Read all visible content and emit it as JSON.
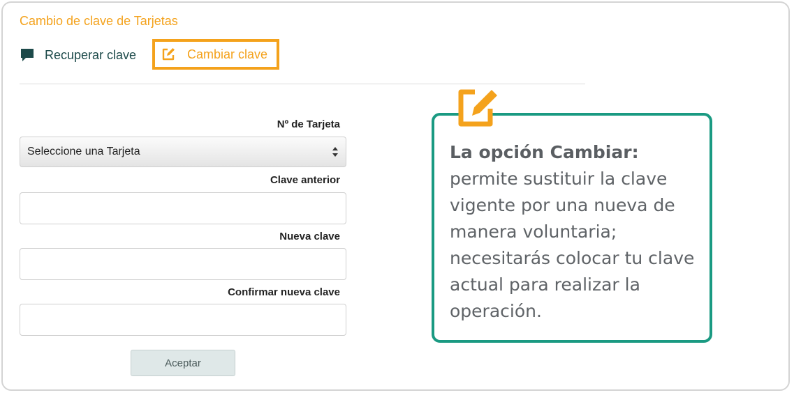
{
  "page": {
    "title": "Cambio de clave de Tarjetas"
  },
  "tabs": [
    {
      "label": "Recuperar clave",
      "icon": "chat-bubble-icon"
    },
    {
      "label": "Cambiar clave",
      "icon": "edit-icon",
      "active": true
    }
  ],
  "form": {
    "card_label": "Nº de Tarjeta",
    "card_select_value": "Seleccione una Tarjeta",
    "old_password_label": "Clave anterior",
    "old_password_value": "",
    "new_password_label": "Nueva clave",
    "new_password_value": "",
    "confirm_password_label": "Confirmar nueva clave",
    "confirm_password_value": "",
    "accept_label": "Aceptar"
  },
  "callout": {
    "lead": "La opción Cambiar:",
    "body": "permite sustituir la clave vigente por una nueva de manera voluntaria; necesitarás colocar tu clave actual para realizar la operación.",
    "icon": "edit-icon"
  },
  "colors": {
    "accent": "#f4a21c",
    "teal": "#1a9a82",
    "dark_teal": "#1d4a4a"
  }
}
